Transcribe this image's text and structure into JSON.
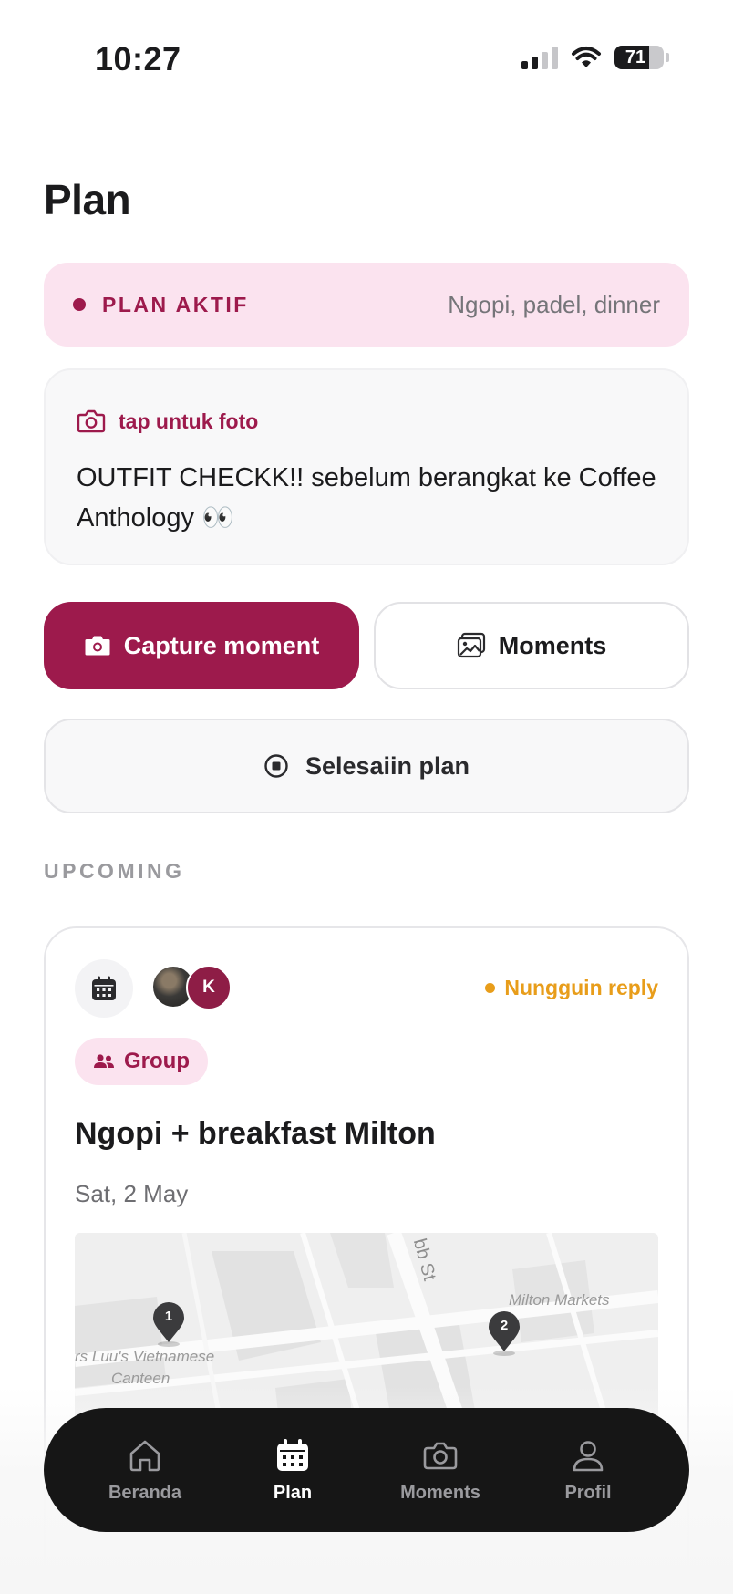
{
  "status_bar": {
    "time": "10:27",
    "battery": "71",
    "battery_level": 0.71,
    "icons": [
      "signal-icon",
      "wifi-icon",
      "battery-icon"
    ]
  },
  "page": {
    "title": "Plan"
  },
  "active_plan": {
    "label": "PLAN AKTIF",
    "description": "Ngopi, padel, dinner"
  },
  "photo_prompt": {
    "hint": "tap untuk foto",
    "text": "OUTFIT CHECKK!! sebelum berangkat ke Coffee Anthology 👀"
  },
  "actions": {
    "capture_label": "Capture moment",
    "moments_label": "Moments",
    "finish_label": "Selesaiin plan"
  },
  "upcoming": {
    "section_label": "UPCOMING",
    "card": {
      "avatar_initial": "K",
      "status": "Nungguin reply",
      "badge": "Group",
      "title": "Ngopi + breakfast Milton",
      "date": "Sat, 2 May",
      "map": {
        "street_label": "bb St",
        "market_label": "Milton Markets",
        "restaurant_label": "rs Luu's Vietnamese",
        "restaurant_label_2": "Canteen",
        "pins": [
          "1",
          "2"
        ]
      }
    }
  },
  "bottom_nav": {
    "items": [
      {
        "label": "Beranda",
        "icon": "home-icon"
      },
      {
        "label": "Plan",
        "icon": "calendar-icon",
        "active": true
      },
      {
        "label": "Moments",
        "icon": "camera-icon"
      },
      {
        "label": "Profil",
        "icon": "profile-icon"
      }
    ]
  },
  "colors": {
    "accent": "#9d1a4c",
    "accent_soft": "#fbe3ef",
    "pending": "#e89d1a",
    "nav_bg": "#161616"
  }
}
